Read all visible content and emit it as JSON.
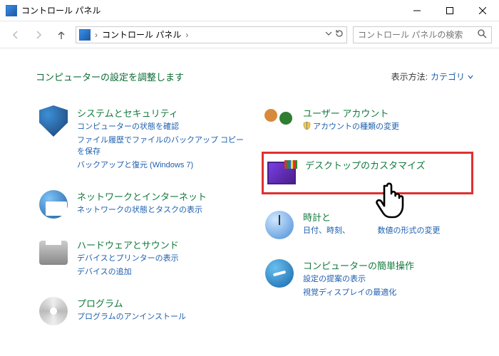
{
  "window": {
    "title": "コントロール パネル"
  },
  "address": {
    "root": "コントロール パネル"
  },
  "search": {
    "placeholder": "コントロール パネルの検索"
  },
  "heading": "コンピューターの設定を調整します",
  "viewby": {
    "label": "表示方法:",
    "value": "カテゴリ"
  },
  "categories": {
    "system_security": {
      "title": "システムとセキュリティ",
      "sub1": "コンピューターの状態を確認",
      "sub2": "ファイル履歴でファイルのバックアップ コピーを保存",
      "sub3": "バックアップと復元 (Windows 7)"
    },
    "network": {
      "title": "ネットワークとインターネット",
      "sub1": "ネットワークの状態とタスクの表示"
    },
    "hardware": {
      "title": "ハードウェアとサウンド",
      "sub1": "デバイスとプリンターの表示",
      "sub2": "デバイスの追加"
    },
    "programs": {
      "title": "プログラム",
      "sub1": "プログラムのアンインストール"
    },
    "user_accounts": {
      "title": "ユーザー アカウント",
      "sub1": "アカウントの種類の変更"
    },
    "appearance": {
      "title": "デスクトップのカスタマイズ"
    },
    "clock_region": {
      "title": "時計と",
      "sub1": "日付、時刻、　　　　数値の形式の変更"
    },
    "ease_of_access": {
      "title": "コンピューターの簡単操作",
      "sub1": "設定の提案の表示",
      "sub2": "視覚ディスプレイの最適化"
    }
  }
}
